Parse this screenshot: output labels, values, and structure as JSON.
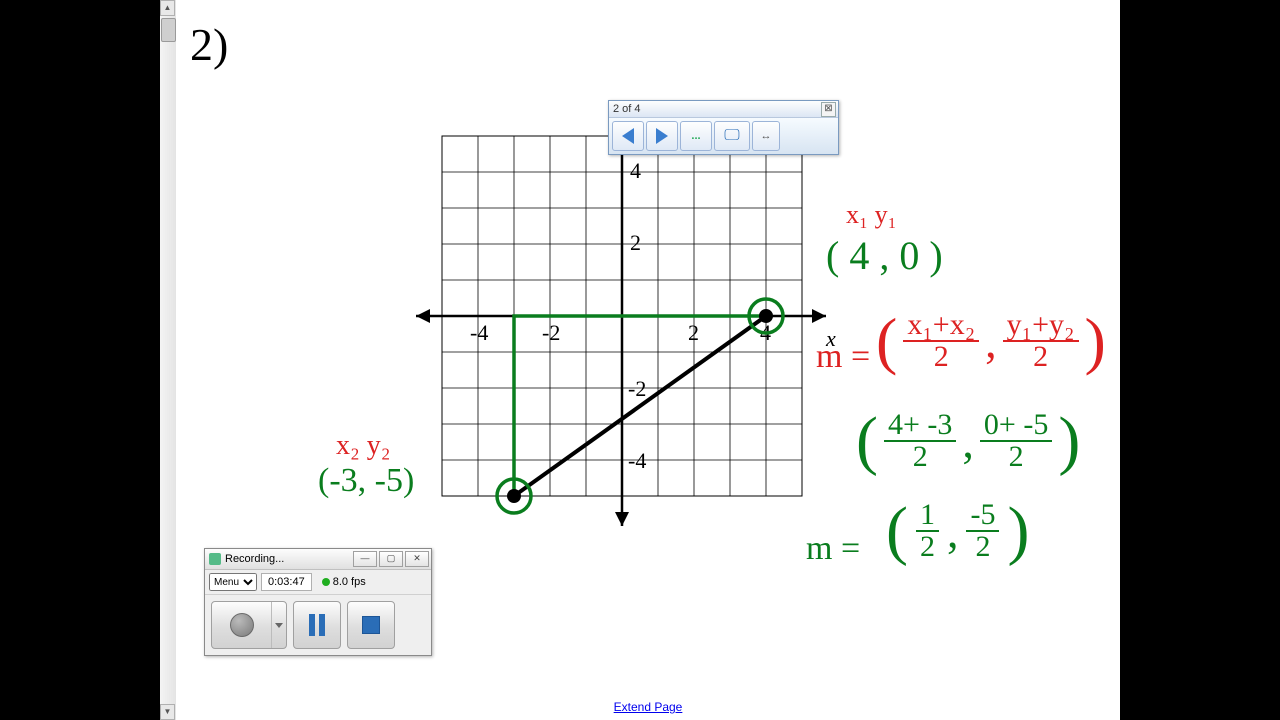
{
  "problem_number": "2)",
  "toolbar": {
    "status": "2 of 4",
    "close": "⊠",
    "prev": "←",
    "next": "→",
    "more": "...",
    "screen": "⛶",
    "fit": "↔"
  },
  "recorder": {
    "title": "Recording...",
    "min": "—",
    "max": "▢",
    "close": "✕",
    "menu_label": "Menu",
    "time": "0:03:47",
    "fps": "8.0 fps",
    "record": "●",
    "pause": "❚❚",
    "stop": "■"
  },
  "footer_link": "Extend Page",
  "chart_data": {
    "type": "line",
    "title": "",
    "xlabel": "x",
    "ylabel": "",
    "xlim": [
      -5,
      5
    ],
    "ylim": [
      -5,
      5
    ],
    "x_ticks": [
      -4,
      -2,
      2,
      4
    ],
    "y_ticks": [
      -4,
      -2,
      2,
      4
    ],
    "points": [
      {
        "name": "P1",
        "x": 4,
        "y": 0,
        "label": "(4, 0)",
        "tag": "x₁ y₁"
      },
      {
        "name": "P2",
        "x": -3,
        "y": -5,
        "label": "(-3, -5)",
        "tag": "x₂ y₂"
      }
    ],
    "segments": [
      {
        "from": [
          -3,
          -5
        ],
        "to": [
          4,
          0
        ],
        "color": "#000"
      },
      {
        "from": [
          -3,
          -5
        ],
        "to": [
          -3,
          0
        ],
        "color": "#0a7d1e"
      },
      {
        "from": [
          -3,
          0
        ],
        "to": [
          4,
          0
        ],
        "color": "#0a7d1e"
      }
    ]
  },
  "annotations": {
    "p1_tag": "x₁  y₁",
    "p1_coord": "( 4 , 0 )",
    "p2_tag": "x₂ y₂",
    "p2_coord": "(-3, -5)",
    "formula_lhs": "m =",
    "formula_mid_comma": ",",
    "f_num1": "x₁+x₂",
    "f_den": "2",
    "f_num2": "y₁+y₂",
    "step2_n1": "4+ -3",
    "step2_n2": "0+ -5",
    "result_lhs": "m =",
    "res_n1": "1",
    "res_n2": "-5"
  }
}
